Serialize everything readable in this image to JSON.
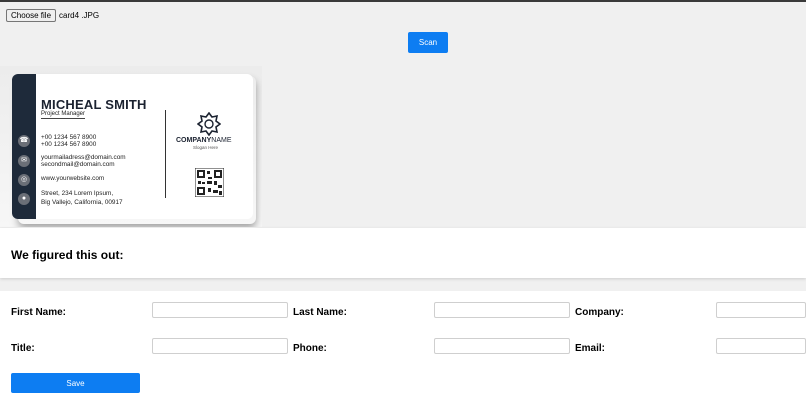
{
  "file_picker": {
    "button_label": "Choose file",
    "file_name": "card4 .JPG"
  },
  "scan_button": {
    "label": "Scan"
  },
  "card_image": {
    "name": "MICHEAL SMITH",
    "role": "Project Manager",
    "phone1": "+00 1234 567 8900",
    "phone2": "+00 1234 567 8900",
    "email1": "yourmailadress@domain.com",
    "email2": "secondmail@domain.com",
    "website": "www.yourwebsite.com",
    "address1": "Street, 234 Lorem Ipsum,",
    "address2": "Big Vallejo, California, 00917",
    "company_bold": "COMPANY",
    "company_light": "NAME",
    "slogan": "Slogan Here",
    "icons": [
      "phone-icon",
      "mail-icon",
      "globe-icon",
      "location-icon"
    ]
  },
  "result": {
    "title": "We figured this out:"
  },
  "form": {
    "first_name_label": "First Name:",
    "last_name_label": "Last Name:",
    "company_label": "Company:",
    "title_label": "Title:",
    "phone_label": "Phone:",
    "email_label": "Email:",
    "first_name_value": "",
    "last_name_value": "",
    "company_value": "",
    "title_value": "",
    "phone_value": "",
    "email_value": ""
  },
  "save_button": {
    "label": "Save"
  },
  "colors": {
    "primary": "#0d7df2",
    "page_bg": "#f0f0f0",
    "card_dark": "#1e2a3a"
  }
}
